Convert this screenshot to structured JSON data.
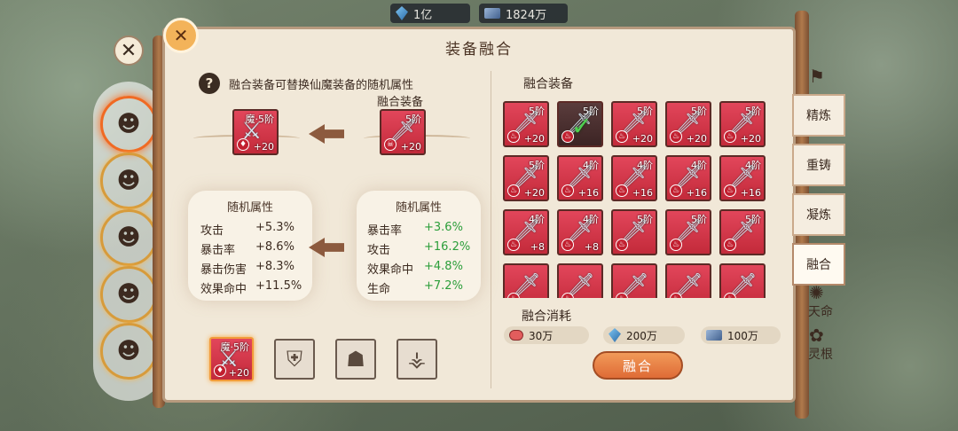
{
  "currency": {
    "spirit_stone": "1亿",
    "iron": "1824万"
  },
  "panel": {
    "title": "装备融合"
  },
  "help": {
    "text": "融合装备可替换仙魔装备的随机属性"
  },
  "source_item": {
    "tier": "魔·5阶",
    "plus": "+20"
  },
  "target_item": {
    "label": "融合装备",
    "tier": "5阶",
    "plus": "+20"
  },
  "left_attrs": {
    "header": "随机属性",
    "rows": [
      {
        "name": "攻击",
        "value": "+5.3%"
      },
      {
        "name": "暴击率",
        "value": "+8.6%"
      },
      {
        "name": "暴击伤害",
        "value": "+8.3%"
      },
      {
        "name": "效果命中",
        "value": "+11.5%"
      }
    ]
  },
  "right_attrs": {
    "header": "随机属性",
    "rows": [
      {
        "name": "暴击率",
        "value": "+3.6%"
      },
      {
        "name": "攻击",
        "value": "+16.2%"
      },
      {
        "name": "效果命中",
        "value": "+4.8%"
      },
      {
        "name": "生命",
        "value": "+7.2%"
      }
    ]
  },
  "slots": [
    {
      "tier": "魔·5阶",
      "plus": "+20",
      "icon": "sword-icon"
    },
    {
      "icon": "armor-icon"
    },
    {
      "icon": "helmet-icon"
    },
    {
      "icon": "boots-icon"
    }
  ],
  "fusion": {
    "title": "融合装备",
    "grid": [
      {
        "tier": "5阶",
        "plus": "+20"
      },
      {
        "tier": "5阶",
        "plus": ""
      },
      {
        "tier": "5阶",
        "plus": "+20"
      },
      {
        "tier": "5阶",
        "plus": "+20"
      },
      {
        "tier": "5阶",
        "plus": "+20"
      },
      {
        "tier": "5阶",
        "plus": "+20"
      },
      {
        "tier": "4阶",
        "plus": "+16"
      },
      {
        "tier": "4阶",
        "plus": "+16"
      },
      {
        "tier": "4阶",
        "plus": "+16"
      },
      {
        "tier": "4阶",
        "plus": "+16"
      },
      {
        "tier": "4阶",
        "plus": "+8"
      },
      {
        "tier": "4阶",
        "plus": "+8"
      },
      {
        "tier": "5阶",
        "plus": ""
      },
      {
        "tier": "5阶",
        "plus": ""
      },
      {
        "tier": "5阶",
        "plus": ""
      },
      {
        "tier": "",
        "plus": ""
      },
      {
        "tier": "",
        "plus": ""
      },
      {
        "tier": "",
        "plus": ""
      },
      {
        "tier": "",
        "plus": ""
      },
      {
        "tier": "",
        "plus": ""
      }
    ]
  },
  "cost": {
    "title": "融合消耗",
    "items": [
      {
        "icon": "meat-icon",
        "amount": "30万"
      },
      {
        "icon": "spirit-stone-icon",
        "amount": "200万"
      },
      {
        "icon": "iron-bar-icon",
        "amount": "100万"
      }
    ]
  },
  "fuse_button": "融合",
  "tabs": [
    "精炼",
    "重铸",
    "凝炼",
    "融合",
    "天命",
    "灵根"
  ],
  "colors": {
    "item_red": "#d83647",
    "accent_orange": "#e87a40",
    "green_value": "#2c9e3a"
  }
}
